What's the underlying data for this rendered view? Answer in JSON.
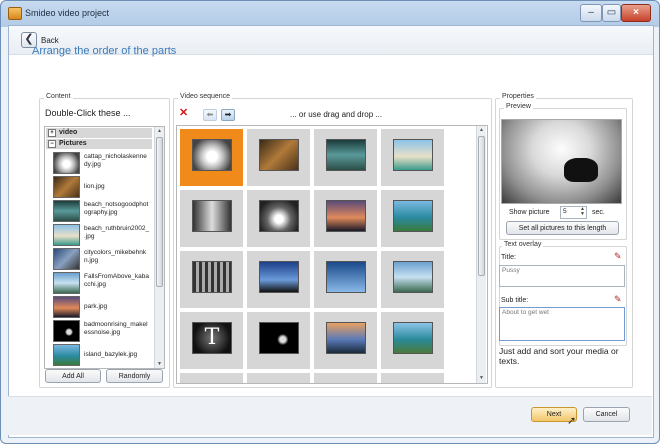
{
  "window": {
    "title": "Smideo video project",
    "caption_buttons": [
      "–",
      "▭",
      "×"
    ]
  },
  "nav": {
    "back_label": "Back"
  },
  "heading": "Arrange the order of the parts",
  "content": {
    "group_label": "Content",
    "hint": "Double-Click these ...",
    "categories": [
      "video",
      "Pictures"
    ],
    "items": [
      {
        "label": "cattap_nicholaskenne dy.jpg",
        "icon": "thumb-cat"
      },
      {
        "label": "lion.jpg",
        "icon": "thumb-lion"
      },
      {
        "label": "beach_notsogoodphot ography.jpg",
        "icon": "thumb-beach"
      },
      {
        "label": "beach_ruthbruin2002_ .jpg",
        "icon": "thumb-beach2"
      },
      {
        "label": "citycolors_mikebehnk n.jpg",
        "icon": "thumb-city"
      },
      {
        "label": "FallsFromAbove_kaba cchi.jpg",
        "icon": "thumb-falls"
      },
      {
        "label": "park.jpg",
        "icon": "thumb-park"
      },
      {
        "label": "badmoonrising_makel essnoise.jpg",
        "icon": "thumb-moon"
      },
      {
        "label": "island_bazylek.jpg",
        "icon": "thumb-island"
      }
    ],
    "add_all_label": "Add All",
    "randomly_label": "Randomly"
  },
  "sequence": {
    "group_label": "Video sequence",
    "drag_hint": "... or use drag and drop ...",
    "cells": [
      {
        "icon": "thumb-cat",
        "selected": true
      },
      {
        "icon": "thumb-lion",
        "selected": false
      },
      {
        "icon": "thumb-beach",
        "selected": false
      },
      {
        "icon": "thumb-beach2",
        "selected": false
      },
      {
        "icon": "thumb-city-bw",
        "selected": false
      },
      {
        "icon": "thumb-flowers",
        "selected": false
      },
      {
        "icon": "thumb-park",
        "selected": false
      },
      {
        "icon": "thumb-island",
        "selected": false
      },
      {
        "icon": "thumb-forest",
        "selected": false
      },
      {
        "icon": "thumb-tower",
        "selected": false
      },
      {
        "icon": "thumb-cranes",
        "selected": false
      },
      {
        "icon": "thumb-falls",
        "selected": false
      },
      {
        "icon": "thumb-t-letter",
        "selected": false
      },
      {
        "icon": "thumb-moon",
        "selected": false
      },
      {
        "icon": "thumb-sunset",
        "selected": false
      },
      {
        "icon": "thumb-coast",
        "selected": false
      }
    ],
    "cell_letter": "T"
  },
  "properties": {
    "group_label": "Properties",
    "preview_label": "Preview",
    "show_picture_label": "Show picture",
    "show_picture_value": "5",
    "seconds_label": "sec.",
    "set_all_label": "Set all pictures to this length",
    "text_overlay_label": "Text overlay",
    "title_label": "Title:",
    "title_value": "Pussy",
    "subtitle_label": "Sub title:",
    "subtitle_value": "About to get wet",
    "help_text": "Just add and sort your media or texts."
  },
  "footer": {
    "next_label": "Next",
    "cancel_label": "Cancel"
  },
  "colors": {
    "accent": "#3a7bb8",
    "selected": "#f08a1a",
    "delete": "#d21717"
  }
}
